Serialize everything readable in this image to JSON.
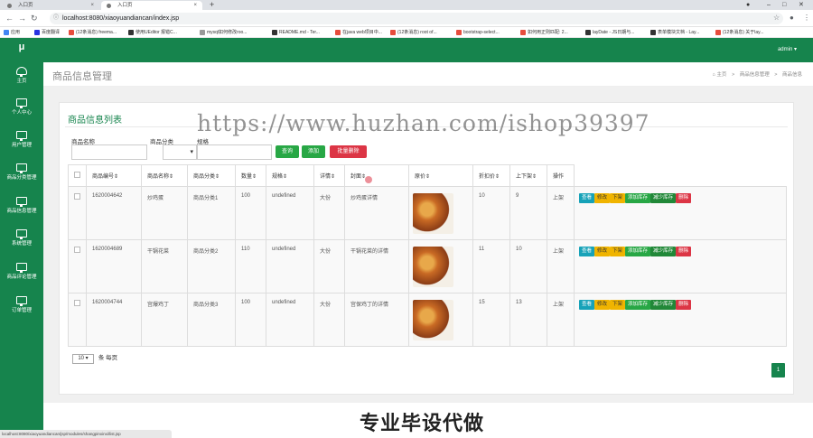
{
  "browser": {
    "tabs": [
      {
        "label": "入口页",
        "active": false
      },
      {
        "label": "入口页",
        "active": true
      }
    ],
    "new_tab": "+",
    "url": "localhost:8080/xiaoyuandiancan/index.jsp",
    "bookmarks": [
      {
        "label": "应用",
        "color": "#4285f4"
      },
      {
        "label": "百度翻译",
        "color": "#2932e1"
      },
      {
        "label": "(12条消息) freema...",
        "color": "#e74c3c"
      },
      {
        "label": "使用UEditor 报错C...",
        "color": "#333333"
      },
      {
        "label": "mysql如何修改roo...",
        "color": "#999999"
      },
      {
        "label": "README.md - Ter...",
        "color": "#333333"
      },
      {
        "label": "在java web项目中...",
        "color": "#e74c3c"
      },
      {
        "label": "(12条消息) root of...",
        "color": "#e74c3c"
      },
      {
        "label": "bootstrap-select...",
        "color": "#e74c3c"
      },
      {
        "label": "如何用正则匹配: 2...",
        "color": "#e74c3c"
      },
      {
        "label": "layDate - JS日期与...",
        "color": "#333333"
      },
      {
        "label": "表单模块文档 - Lay...",
        "color": "#333333"
      },
      {
        "label": "(12条消息) 关于lay...",
        "color": "#e74c3c"
      }
    ]
  },
  "sidebar": {
    "logo": "μ",
    "items": [
      {
        "label": "主页",
        "icon": "dashboard-icon"
      },
      {
        "label": "个人中心",
        "icon": "monitor-icon"
      },
      {
        "label": "用户管理",
        "icon": "monitor-icon"
      },
      {
        "label": "商品分类管理",
        "icon": "monitor-icon"
      },
      {
        "label": "商品信息管理",
        "icon": "monitor-icon"
      },
      {
        "label": "系统管理",
        "icon": "monitor-icon"
      },
      {
        "label": "商品评论管理",
        "icon": "monitor-icon"
      },
      {
        "label": "订单管理",
        "icon": "monitor-icon"
      }
    ]
  },
  "topbar": {
    "user": "admin ▾"
  },
  "header": {
    "title": "商品信息管理",
    "breadcrumb": [
      "⌂ 主页",
      ">",
      "商品信息管理",
      ">",
      "商品信息"
    ]
  },
  "card": {
    "title": "商品信息列表",
    "filters": {
      "name_label": "商品名称",
      "category_label": "商品分类",
      "spec_label": "规格"
    },
    "buttons": {
      "search": "查询",
      "add": "添加",
      "batch_delete": "批量删除"
    },
    "table": {
      "headers": [
        "商品编号⇕",
        "商品名称⇕",
        "商品分类⇕",
        "数量⇕",
        "规格⇕",
        "详情⇕",
        "封面⇕",
        "原价⇕",
        "折扣价⇕",
        "上下架⇕",
        "操作"
      ],
      "rows": [
        {
          "code": "1620004642",
          "name": "炒鸡蛋",
          "category": "商品分类1",
          "qty": "100",
          "spec": "undefined",
          "detail": "大份",
          "desc": "炒鸡蛋详情",
          "price": "10",
          "discount": "9",
          "status": "上架"
        },
        {
          "code": "1620004689",
          "name": "干锅花菜",
          "category": "商品分类2",
          "qty": "110",
          "spec": "undefined",
          "detail": "大份",
          "desc": "干锅花菜的详情",
          "price": "11",
          "discount": "10",
          "status": "上架"
        },
        {
          "code": "1620004744",
          "name": "宫爆鸡丁",
          "category": "商品分类3",
          "qty": "100",
          "spec": "undefined",
          "detail": "大份",
          "desc": "宫保鸡丁的详情",
          "price": "15",
          "discount": "13",
          "status": "上架"
        }
      ],
      "row_actions": [
        "查看",
        "修改",
        "下架",
        "添加库存",
        "减少库存",
        "删除"
      ]
    },
    "pager": {
      "page_size": "10",
      "per_page_label": "条 每页",
      "current_page": "1"
    }
  },
  "overlay": {
    "watermark": "https://www.huzhan.com/ishop39397",
    "promo": "专业毕设代做",
    "status_url": "localhost:8080/xiaoyuandiancan/jsp/modules/shangpinxinxi/list.jsp"
  },
  "colors": {
    "brand": "#16844d",
    "danger": "#dc3545",
    "info": "#17a2b8",
    "warning": "#f0b400"
  }
}
